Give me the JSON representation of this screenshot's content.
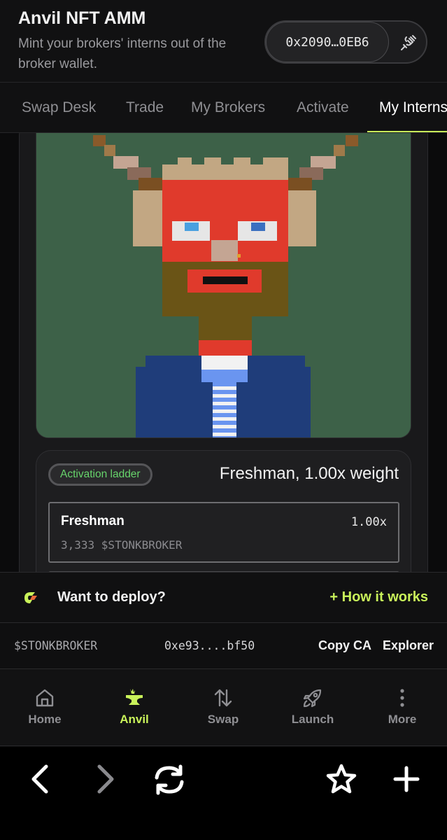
{
  "header": {
    "title": "Anvil NFT AMM",
    "subtitle": "Mint your brokers' interns out of the broker wallet.",
    "wallet_address": "0x2090…0EB6",
    "disconnect_icon": "plug-disconnect-icon"
  },
  "tabs": [
    {
      "label": "Swap Desk",
      "active": false
    },
    {
      "label": "Trade",
      "active": false
    },
    {
      "label": "My Brokers",
      "active": false
    },
    {
      "label": "Activate",
      "active": false
    },
    {
      "label": "My Interns",
      "active": true
    }
  ],
  "ladder": {
    "badge": "Activation ladder",
    "status": "Freshman, 1.00x weight",
    "tiers": [
      {
        "name": "Freshman",
        "multiplier": "1.00x",
        "cost": "3,333 $STONKBROKER"
      }
    ]
  },
  "deploy_bar": {
    "text": "Want to deploy?",
    "link": "+ How it works"
  },
  "token_bar": {
    "symbol": "$STONKBROKER",
    "contract": "0xe93....bf50",
    "copy_label": "Copy CA",
    "explorer_label": "Explorer"
  },
  "bottom_nav": [
    {
      "label": "Home",
      "icon": "home-icon",
      "active": false
    },
    {
      "label": "Anvil",
      "icon": "anvil-icon",
      "active": true
    },
    {
      "label": "Swap",
      "icon": "swap-arrows-icon",
      "active": false
    },
    {
      "label": "Launch",
      "icon": "rocket-icon",
      "active": false
    },
    {
      "label": "More",
      "icon": "more-vertical-icon",
      "active": false
    }
  ],
  "colors": {
    "accent": "#c9f25a",
    "badge_text": "#67d46b",
    "art_background": "#3d6148"
  }
}
